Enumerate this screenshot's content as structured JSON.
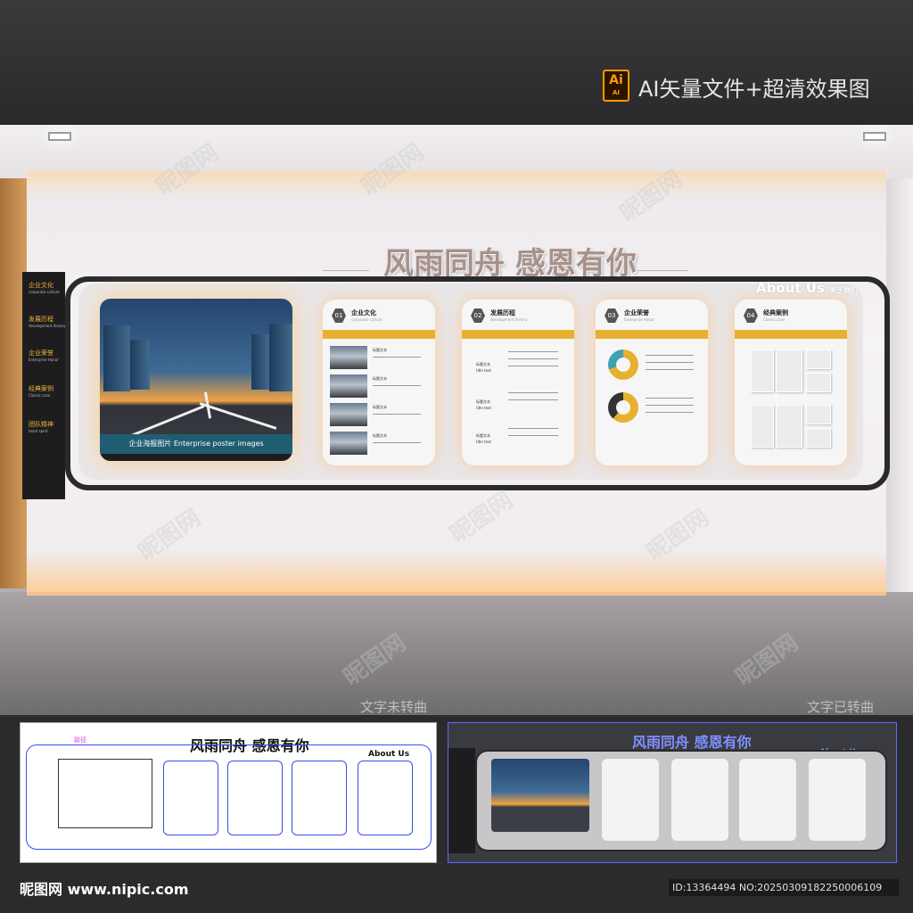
{
  "header": {
    "badge_main": "Ai",
    "badge_sub": "AI",
    "title": "AI矢量文件+超清效果图"
  },
  "wall": {
    "headline": "风雨同舟 感恩有你",
    "about_en": "About Us",
    "about_cn": "关于我们",
    "side_menu": [
      {
        "cn": "企业文化",
        "en": "corporate culture"
      },
      {
        "cn": "发展历程",
        "en": "development history"
      },
      {
        "cn": "企业荣誉",
        "en": "Enterprise Honor"
      },
      {
        "cn": "经典案例",
        "en": "Classic case"
      },
      {
        "cn": "团队精神",
        "en": "team spirit"
      }
    ],
    "poster_caption": "企业海报图片    Enterprise poster images",
    "panels": [
      {
        "num": "01",
        "title": "企业文化",
        "subtitle": "corporate culture",
        "item_title": "标题文本",
        "item_sub": "title text"
      },
      {
        "num": "02",
        "title": "发展历程",
        "subtitle": "development history",
        "item_title": "标题文本",
        "item_sub": "title text"
      },
      {
        "num": "03",
        "title": "企业荣誉",
        "subtitle": "Enterprise Honor"
      },
      {
        "num": "04",
        "title": "经典案例",
        "subtitle": "Classic case"
      }
    ],
    "watermark": "昵图网"
  },
  "compare": {
    "left_label": "文字未转曲",
    "right_label": "文字已转曲",
    "left_tag": "路径"
  },
  "footer": {
    "brand": "昵图网 www.nipic.com",
    "id_text": "ID:13364494 NO:20250309182250006109"
  },
  "colors": {
    "accent_yellow": "#e8b030",
    "badge_orange": "#ff9a00",
    "poster_teal": "#1f5e72",
    "outline_blue": "#3b4cf0"
  }
}
